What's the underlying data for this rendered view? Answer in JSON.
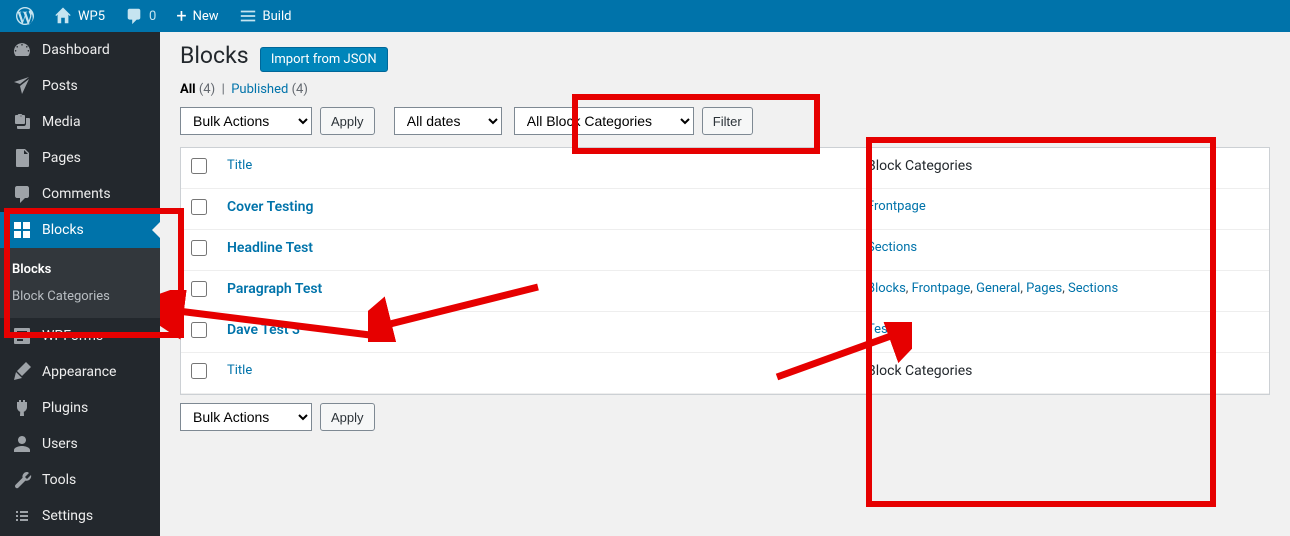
{
  "adminbar": {
    "site_name": "WP5",
    "comments_count": "0",
    "new_label": "New",
    "build_label": "Build"
  },
  "sidebar": {
    "items": [
      {
        "label": "Dashboard"
      },
      {
        "label": "Posts"
      },
      {
        "label": "Media"
      },
      {
        "label": "Pages"
      },
      {
        "label": "Comments"
      },
      {
        "label": "Blocks"
      },
      {
        "label": "WPForms"
      },
      {
        "label": "Appearance"
      },
      {
        "label": "Plugins"
      },
      {
        "label": "Users"
      },
      {
        "label": "Tools"
      },
      {
        "label": "Settings"
      }
    ],
    "submenu": {
      "items": [
        "Blocks",
        "Block Categories"
      ]
    }
  },
  "page": {
    "title": "Blocks",
    "action_button": "Import from JSON"
  },
  "views": {
    "all_label": "All",
    "all_count": "(4)",
    "published_label": "Published",
    "published_count": "(4)"
  },
  "filters": {
    "bulk_actions": "Bulk Actions",
    "apply": "Apply",
    "dates": "All dates",
    "categories": "All Block Categories",
    "filter": "Filter"
  },
  "columns": {
    "title": "Title",
    "categories": "Block Categories"
  },
  "rows": [
    {
      "title": "Cover Testing",
      "cats": [
        "Frontpage"
      ]
    },
    {
      "title": "Headline Test",
      "cats": [
        "Sections"
      ]
    },
    {
      "title": "Paragraph Test",
      "cats": [
        "Blocks",
        "Frontpage",
        "General",
        "Pages",
        "Sections"
      ]
    },
    {
      "title": "Dave Test 3",
      "cats": [
        "Testing"
      ]
    }
  ]
}
